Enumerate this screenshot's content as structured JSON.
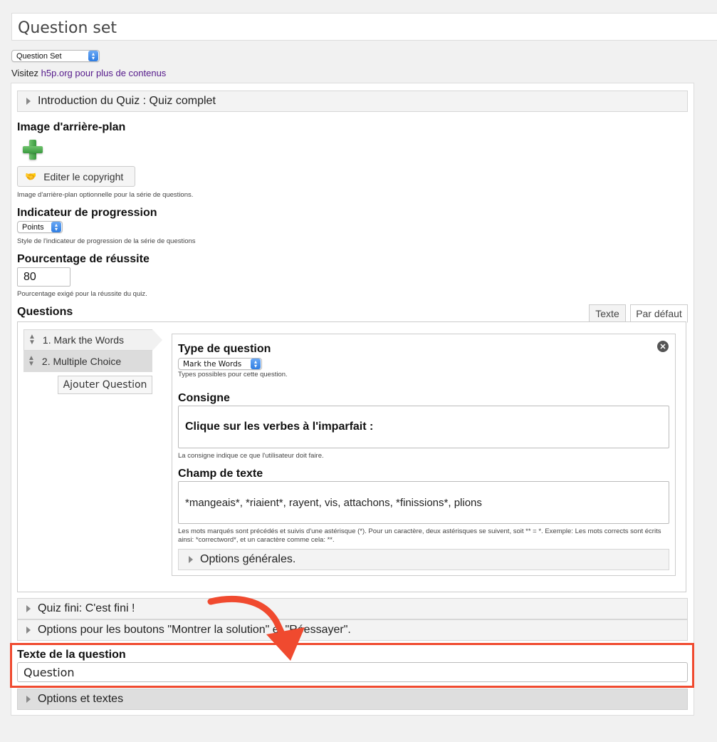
{
  "header": {
    "title": "Question set"
  },
  "library": {
    "selected": "Question Set"
  },
  "visit": {
    "prefix": "Visitez ",
    "link": "h5p.org pour plus de contenus"
  },
  "intro": {
    "label": "Introduction du Quiz : Quiz complet"
  },
  "background": {
    "label": "Image d'arrière-plan",
    "copyright_button": "Editer le copyright",
    "description": "Image d'arrière-plan optionnelle pour la série de questions."
  },
  "progress": {
    "label": "Indicateur de progression",
    "selected": "Points",
    "description": "Style de l'indicateur de progression de la série de questions"
  },
  "pass": {
    "label": "Pourcentage de réussite",
    "value": "80",
    "description": "Pourcentage exigé pour la réussite du quiz."
  },
  "questions": {
    "label": "Questions",
    "tabs": [
      "Texte",
      "Par défaut"
    ],
    "items": [
      "1. Mark the Words",
      "2. Multiple Choice"
    ],
    "add_button": "Ajouter Question"
  },
  "editor": {
    "type_label": "Type de question",
    "type_selected": "Mark the Words",
    "type_description": "Types possibles pour cette question.",
    "consigne_label": "Consigne",
    "consigne_value": "Clique sur les verbes à l'imparfait :",
    "consigne_description": "La consigne indique ce que l'utilisateur doit faire.",
    "champ_label": "Champ de texte",
    "champ_value": "*mangeais*, *riaient*, rayent, vis, attachons, *finissions*, plions",
    "champ_description": "Les mots marqués sont précédés et suivis d'une astérisque (*). Pour un caractère, deux astérisques se suivent, soit ** = *. Exemple: Les mots corrects sont écrits ainsi: *correctword*, et un caractère comme cela: **.",
    "general_options": "Options générales."
  },
  "quiz_end": {
    "label": "Quiz fini: C'est fini !"
  },
  "buttons_options": {
    "label": "Options pour les boutons \"Montrer la solution\" et \"Réessayer\"."
  },
  "question_text": {
    "label": "Texte de la question",
    "value": "Question"
  },
  "options_texts": {
    "label": "Options et textes"
  },
  "colors": {
    "highlight": "#f04a2f",
    "link": "#551a8b",
    "select_accent": "#2f7de1"
  }
}
